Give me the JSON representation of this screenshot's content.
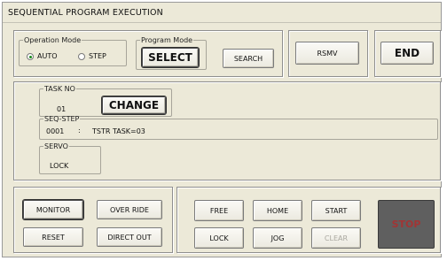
{
  "window": {
    "title": "SEQUENTIAL PROGRAM EXECUTION"
  },
  "operation_mode": {
    "legend": "Operation Mode",
    "options": [
      {
        "label": "AUTO",
        "selected": true
      },
      {
        "label": "STEP",
        "selected": false
      }
    ]
  },
  "program_mode": {
    "legend": "Program Mode",
    "select_label": "SELECT"
  },
  "toolbar": {
    "search_label": "SEARCH",
    "rsmv_label": "RSMV",
    "end_label": "END"
  },
  "task": {
    "legend": "TASK NO",
    "value": "01",
    "change_label": "CHANGE"
  },
  "seq_step": {
    "legend": "SEQ-STEP",
    "step": "0001",
    "separator": ":",
    "instruction": "TSTR TASK=03"
  },
  "servo": {
    "legend": "SERVO",
    "value": "LOCK"
  },
  "controls": {
    "monitor_label": "MONITOR",
    "override_label": "OVER RIDE",
    "reset_label": "RESET",
    "direct_out_label": "DIRECT OUT",
    "free_label": "FREE",
    "home_label": "HOME",
    "start_label": "START",
    "lock_label": "LOCK",
    "jog_label": "JOG",
    "clear_label": "CLEAR",
    "stop_label": "STOP"
  },
  "colors": {
    "window_bg": "#ece9d8",
    "stop_bg": "#5f5f5f",
    "stop_text": "#a13535",
    "radio_dot": "#1a8a1a"
  }
}
